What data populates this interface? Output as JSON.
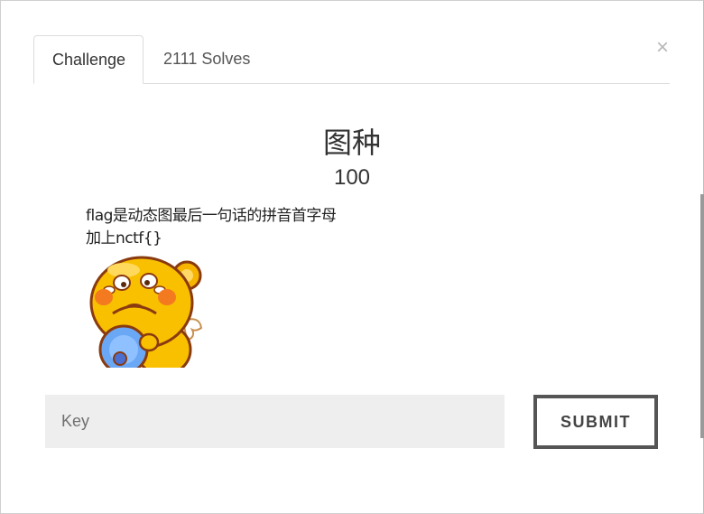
{
  "tabs": [
    {
      "label": "Challenge"
    },
    {
      "label": "2111 Solves"
    }
  ],
  "close_symbol": "×",
  "challenge": {
    "name": "图种",
    "value": "100",
    "description_line1": "flag是动态图最后一句话的拼音首字母",
    "description_line2": "加上nctf{}"
  },
  "form": {
    "key_placeholder": "Key",
    "submit_label": "SUBMIT"
  },
  "image": {
    "icon": "crying-cartoon-character-gif"
  }
}
